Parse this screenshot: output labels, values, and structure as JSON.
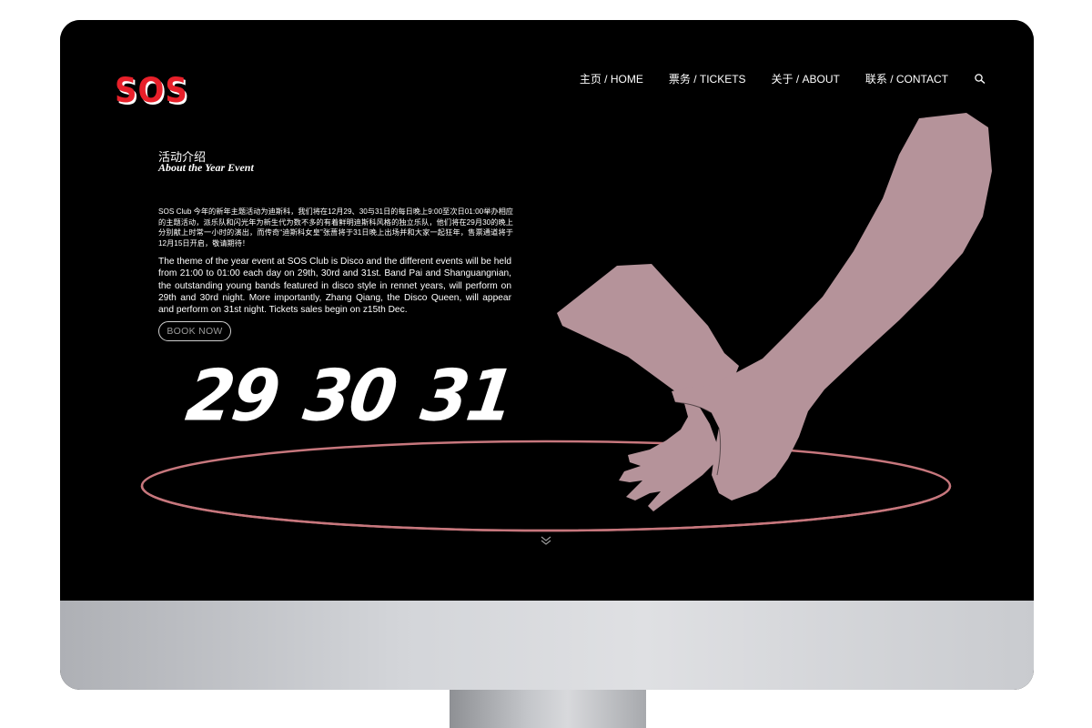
{
  "brand": {
    "logo_text": "SOS",
    "logo_color": "#e8202a"
  },
  "nav": {
    "items": [
      {
        "label": "主页 / HOME"
      },
      {
        "label": "票务 / TICKETS"
      },
      {
        "label": "关于 / ABOUT"
      },
      {
        "label": "联系 / CONTACT"
      }
    ],
    "search_icon": "search-icon"
  },
  "intro": {
    "heading_zh": "活动介绍",
    "heading_en": "About the Year Event",
    "body_zh": "SOS Club 今年的新年主题活动为迪斯科，我们将在12月29、30与31日的每日晚上9:00至次日01:00举办相应的主题活动，派乐队和闪光年为新生代为数不多的有着鲜明迪斯科风格的独立乐队，他们将在29月30的晚上分别献上时常一小时的演出，而传奇“迪斯科女皇”张蔷将于31日晚上出场并和大家一起狂年，售票通道将于12月15日开启，敬请期待！",
    "body_en": "The theme of the year event at SOS Club is Disco and the different events will be held from 21:00 to 01:00 each day on 29th, 30rd and 31st. Band Pai and Shanguangnian, the outstanding young bands featured in disco style in rennet years, will perform on 29th and 30rd night. More importantly, Zhang Qiang, the Disco Queen, will appear and perform on 31st night. Tickets sales begin on z15th Dec.",
    "book_button": "BOOK NOW"
  },
  "dates": [
    "29",
    "30",
    "31"
  ],
  "colors": {
    "background": "#000000",
    "arm": "#b5939a",
    "ring": "#c7777d",
    "text": "#ffffff"
  },
  "scroll_icon": "double-chevron-down-icon"
}
